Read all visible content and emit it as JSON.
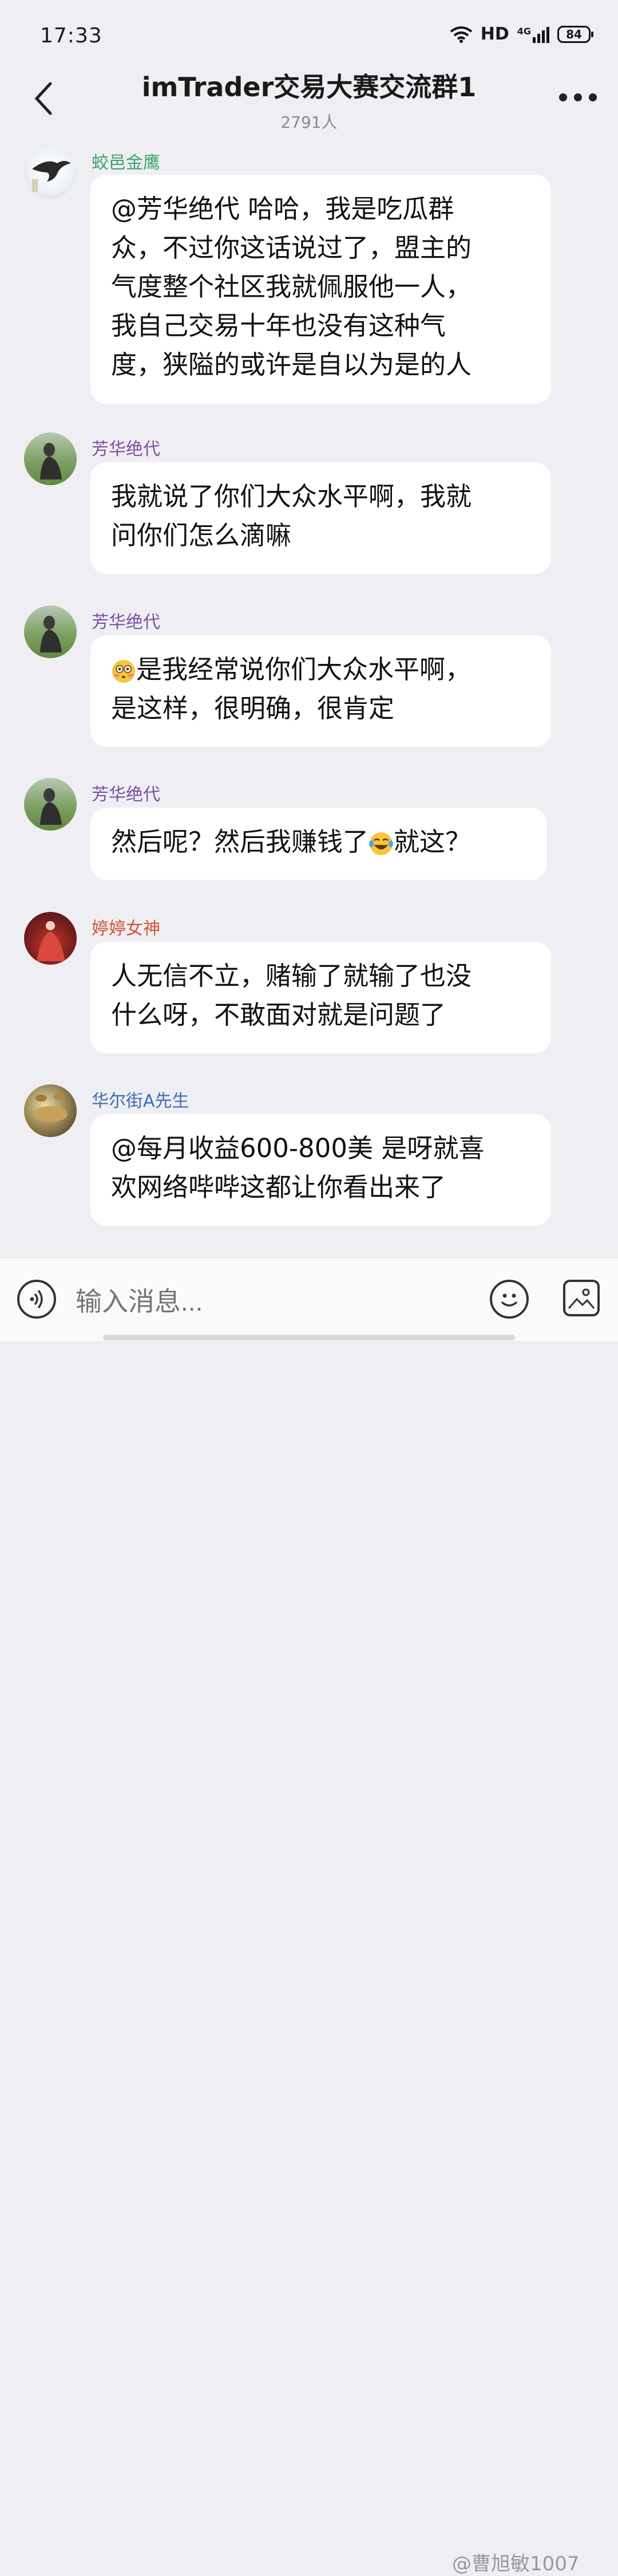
{
  "status_bar": {
    "time": "17:33",
    "network": "HD",
    "signal": "4G",
    "battery": "84"
  },
  "header": {
    "title": "imTrader交易大赛交流群1",
    "member_count": "2791人"
  },
  "messages": [
    {
      "sender": "蛟邑金鹰",
      "name_color": "#3aa36b",
      "text": "@芳华绝代 哈哈，我是吃瓜群众，不过你这话说过了，盟主的气度整个社区我就佩服他一人，我自己交易十年也没有这种气度，狭隘的或许是自以为是的人",
      "lines": [
        "@芳华绝代 哈哈，我是吃瓜群",
        "众，不过你这话说过了，盟主的",
        "气度整个社区我就佩服他一人，",
        "我自己交易十年也没有这种气",
        "度，狭隘的或许是自以为是的人"
      ]
    },
    {
      "sender": "芳华绝代",
      "name_color": "#7a4fa3",
      "text": "我就说了你们大众水平啊，我就问你们怎么滴嘛",
      "lines": [
        "我就说了你们大众水平啊，我就",
        "问你们怎么滴嘛"
      ]
    },
    {
      "sender": "芳华绝代",
      "name_color": "#7a4fa3",
      "text": "😳是我经常说你们大众水平啊，是这样，很明确，很肯定",
      "lines": [
        "是我经常说你们大众水平啊，",
        "是这样，很明确，很肯定"
      ],
      "leading_emoji": "flushed-face"
    },
    {
      "sender": "芳华绝代",
      "name_color": "#7a4fa3",
      "text": "然后呢？然后我赚钱了😂就这？",
      "lines_parts": [
        "然后呢？然后我赚钱了",
        "就这？"
      ],
      "inline_emoji": "tears-of-joy"
    },
    {
      "sender": "婷婷女神",
      "name_color": "#d2553c",
      "text": "人无信不立，赌输了就输了也没什么呀，不敢面对就是问题了",
      "lines": [
        "人无信不立，赌输了就输了也没",
        "什么呀，不敢面对就是问题了"
      ]
    },
    {
      "sender": "华尔街A先生",
      "name_color": "#3b6db3",
      "text": "@每月收益600-800美 是呀就喜欢网络哔哔这都让你看出来了",
      "lines": [
        "@每月收益600-800美 是呀就喜",
        "欢网络哔哔这都让你看出来了"
      ]
    }
  ],
  "input": {
    "placeholder": "输入消息..."
  },
  "watermark": "@曹旭敏1007"
}
